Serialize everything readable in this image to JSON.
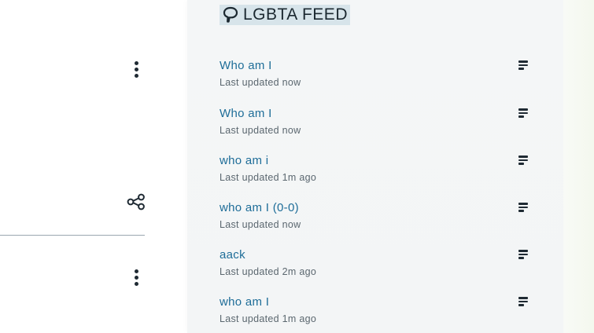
{
  "feed": {
    "title": "LGBTA FEED",
    "title_icon": "speech-bubble-icon",
    "items": [
      {
        "title": "Who am I",
        "updated": "Last updated now"
      },
      {
        "title": "Who am I",
        "updated": "Last updated now"
      },
      {
        "title": "who am i",
        "updated": "Last updated 1m ago"
      },
      {
        "title": "who am I (0-0)",
        "updated": "Last updated now"
      },
      {
        "title": "aack",
        "updated": "Last updated 2m ago"
      },
      {
        "title": "who am I",
        "updated": "Last updated 1m ago"
      }
    ],
    "item_menu_icon": "lines-menu-icon"
  },
  "sidebar": {
    "icons": [
      "more-vertical-icon",
      "share-icon",
      "more-vertical-icon"
    ]
  },
  "colors": {
    "link": "#1e6d98",
    "meta": "#5b676f",
    "title_highlight": "#d7e4ea",
    "panel": "#f4f6f7"
  }
}
